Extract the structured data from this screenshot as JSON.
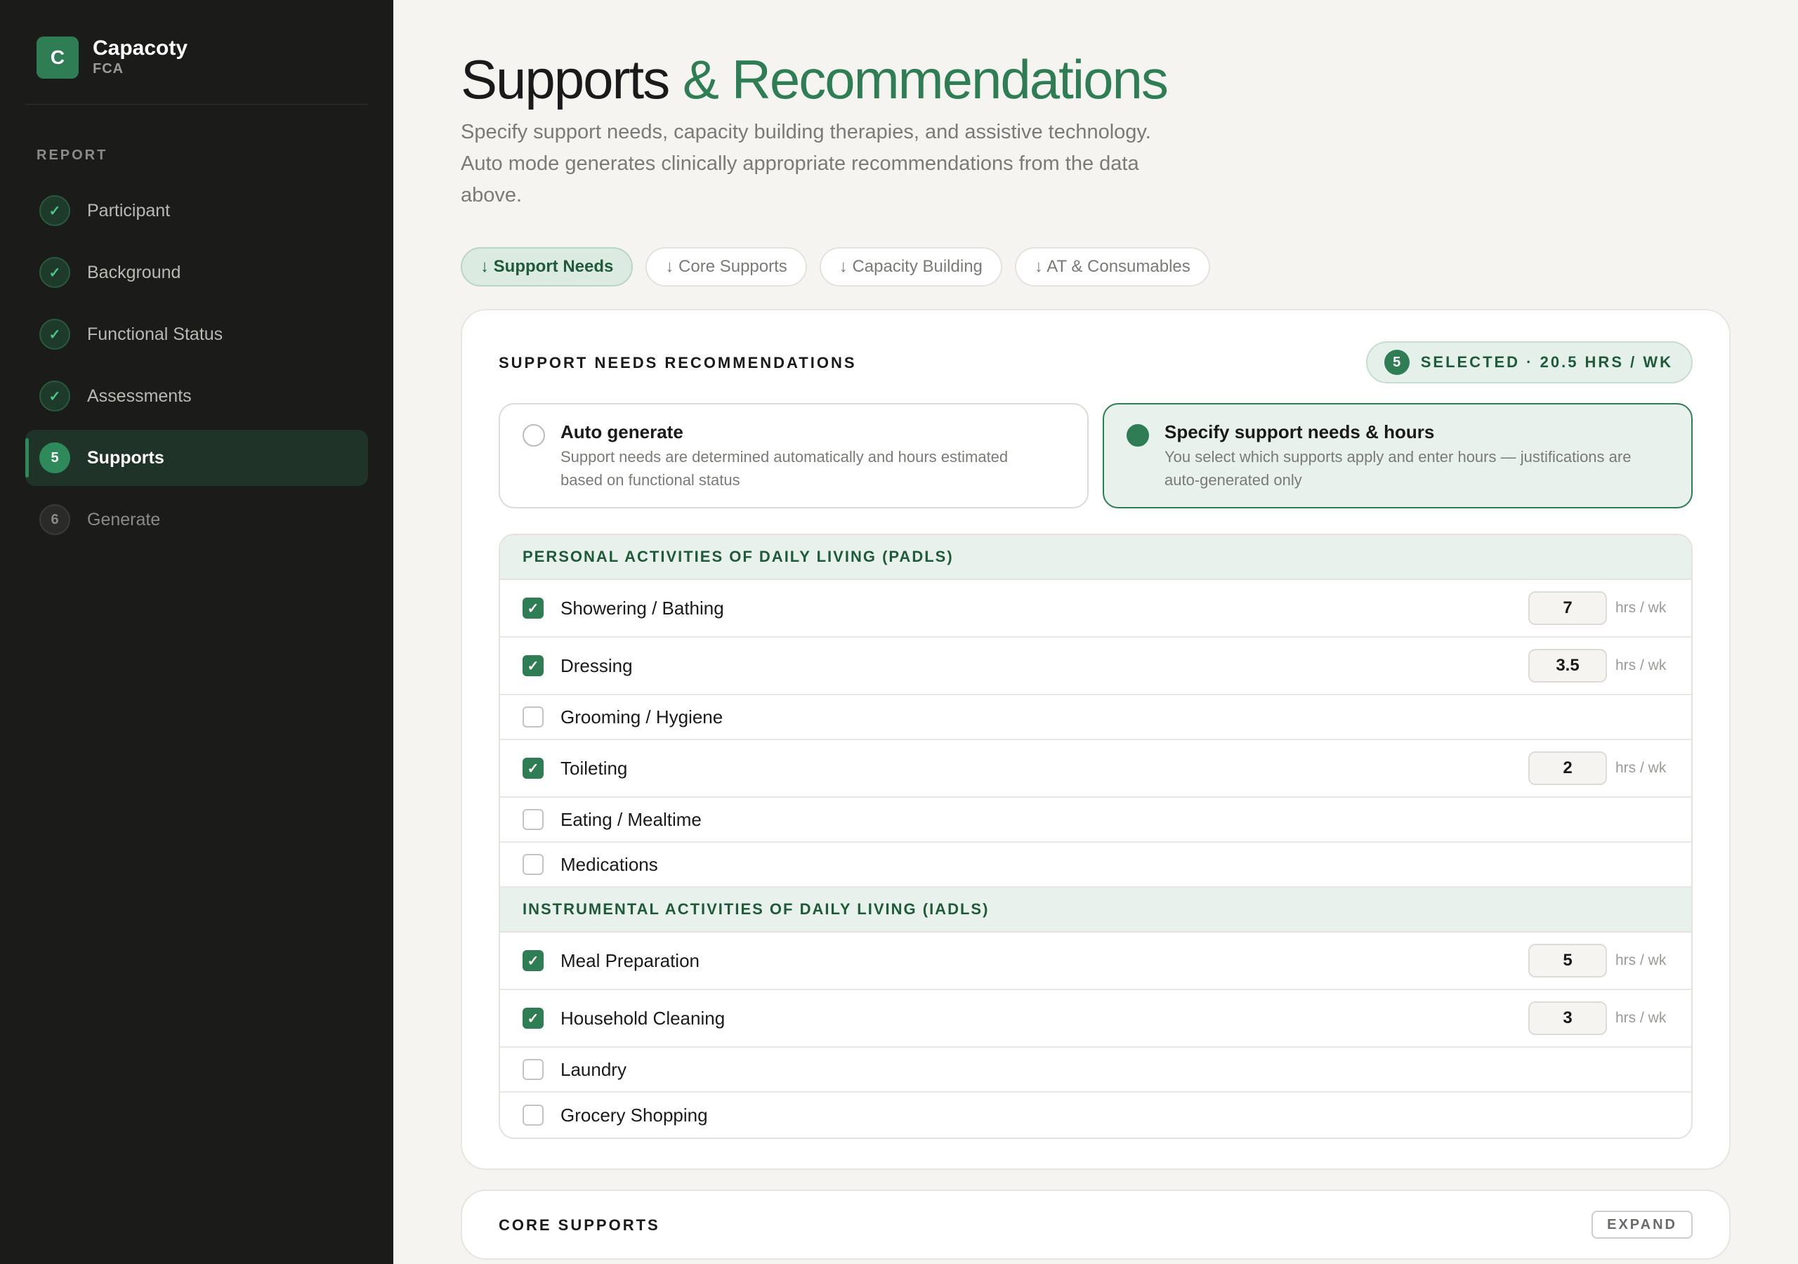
{
  "brand": {
    "logo_letter": "C",
    "name": "Capacoty",
    "sub": "FCA"
  },
  "sidebar": {
    "section_label": "REPORT",
    "items": [
      {
        "label": "Participant",
        "badge": "✓",
        "state": "done"
      },
      {
        "label": "Background",
        "badge": "✓",
        "state": "done"
      },
      {
        "label": "Functional Status",
        "badge": "✓",
        "state": "done"
      },
      {
        "label": "Assessments",
        "badge": "✓",
        "state": "done"
      },
      {
        "label": "Supports",
        "badge": "5",
        "state": "current"
      },
      {
        "label": "Generate",
        "badge": "6",
        "state": "todo"
      }
    ]
  },
  "page": {
    "title_main": "Supports",
    "title_accent": "& Recommendations",
    "description": "Specify support needs, capacity building therapies, and assistive technology. Auto mode generates clinically appropriate recommendations from the data above."
  },
  "tabs": [
    {
      "label": "↓ Support Needs",
      "active": true
    },
    {
      "label": "↓ Core Supports",
      "active": false
    },
    {
      "label": "↓ Capacity Building",
      "active": false
    },
    {
      "label": "↓ AT & Consumables",
      "active": false
    }
  ],
  "support_needs": {
    "title": "SUPPORT NEEDS RECOMMENDATIONS",
    "selected_count": "5",
    "selected_text": "SELECTED · 20.5 HRS / WK",
    "modes": [
      {
        "title": "Auto generate",
        "description": "Support needs are determined automatically and hours estimated based on functional status",
        "selected": false
      },
      {
        "title": "Specify support needs & hours",
        "description": "You select which supports apply and enter hours — justifications are auto-generated only",
        "selected": true
      }
    ],
    "unit_label": "hrs / wk",
    "groups": [
      {
        "heading": "PERSONAL ACTIVITIES OF DAILY LIVING (PADLS)",
        "items": [
          {
            "label": "Showering / Bathing",
            "checked": true,
            "hours": "7"
          },
          {
            "label": "Dressing",
            "checked": true,
            "hours": "3.5"
          },
          {
            "label": "Grooming / Hygiene",
            "checked": false,
            "hours": ""
          },
          {
            "label": "Toileting",
            "checked": true,
            "hours": "2"
          },
          {
            "label": "Eating / Mealtime",
            "checked": false,
            "hours": ""
          },
          {
            "label": "Medications",
            "checked": false,
            "hours": ""
          }
        ]
      },
      {
        "heading": "INSTRUMENTAL ACTIVITIES OF DAILY LIVING (IADLS)",
        "items": [
          {
            "label": "Meal Preparation",
            "checked": true,
            "hours": "5"
          },
          {
            "label": "Household Cleaning",
            "checked": true,
            "hours": "3"
          },
          {
            "label": "Laundry",
            "checked": false,
            "hours": ""
          },
          {
            "label": "Grocery Shopping",
            "checked": false,
            "hours": ""
          }
        ]
      }
    ]
  },
  "core_supports": {
    "title": "CORE SUPPORTS",
    "expand_label": "EXPAND"
  },
  "colors": {
    "accent": "#2e7d55",
    "sidebar_bg": "#1b1b1a",
    "page_bg": "#f5f4f0",
    "group_bg": "#e9f1ec"
  }
}
